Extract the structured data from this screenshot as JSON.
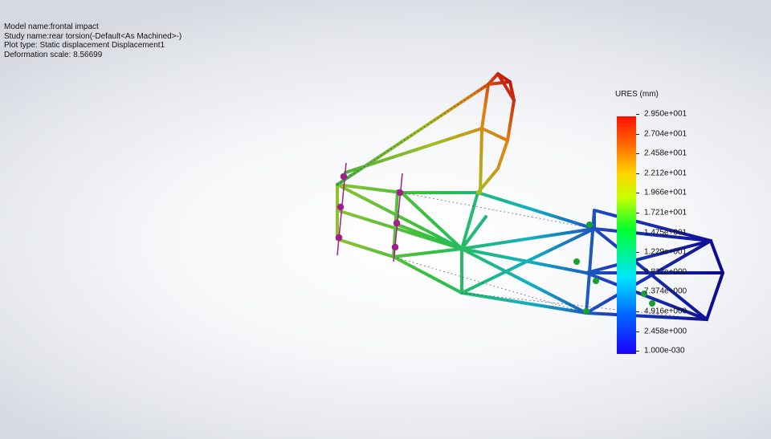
{
  "info": {
    "model_name": "Model name:frontal impact",
    "study_name": "Study name:rear torsion(-Default<As Machined>-)",
    "plot_type": "Plot type: Static displacement Displacement1",
    "deformation_scale": "Deformation scale: 8.56699"
  },
  "legend": {
    "title": "URES (mm)",
    "ticks": [
      "2.950e+001",
      "2.704e+001",
      "2.458e+001",
      "2.212e+001",
      "1.966e+001",
      "1.721e+001",
      "1.475e+001",
      "1.229e+001",
      "9.832e+000",
      "7.374e+000",
      "4.916e+000",
      "2.458e+000",
      "1.000e-030"
    ]
  }
}
